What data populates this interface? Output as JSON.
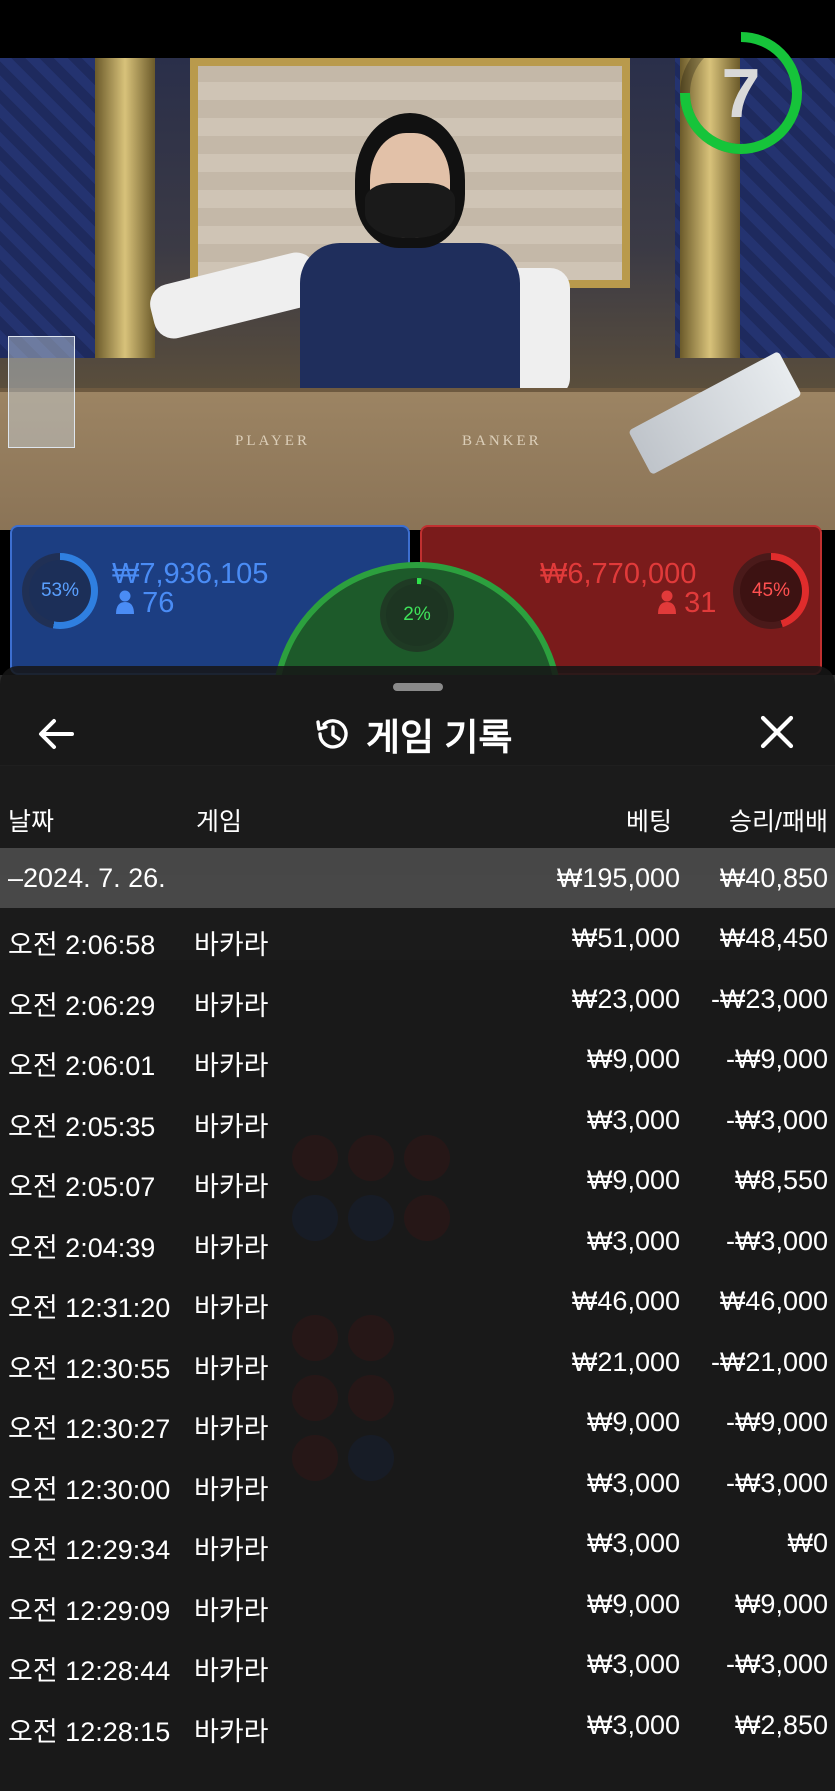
{
  "video": {
    "countdown": "7",
    "table_labels": [
      "PLAYER",
      "BANKER"
    ]
  },
  "bets": {
    "player": {
      "percent": "53%",
      "amount": "₩7,936,105",
      "count": "76",
      "color": "#2f7fe0"
    },
    "banker": {
      "percent": "45%",
      "amount": "₩6,770,000",
      "count": "31",
      "color": "#e02c2c"
    },
    "tie": {
      "percent": "2%",
      "color": "#2ee04a"
    }
  },
  "history": {
    "title": "게임 기록",
    "columns": {
      "date": "날짜",
      "game": "게임",
      "bet": "베팅",
      "result": "승리/패배"
    },
    "summary": {
      "date": "–2024. 7. 26.",
      "bet": "₩195,000",
      "result": "₩40,850"
    },
    "rows": [
      {
        "time": "오전 2:06:58",
        "game": "바카라",
        "bet": "₩51,000",
        "result": "₩48,450"
      },
      {
        "time": "오전 2:06:29",
        "game": "바카라",
        "bet": "₩23,000",
        "result": "-₩23,000"
      },
      {
        "time": "오전 2:06:01",
        "game": "바카라",
        "bet": "₩9,000",
        "result": "-₩9,000"
      },
      {
        "time": "오전 2:05:35",
        "game": "바카라",
        "bet": "₩3,000",
        "result": "-₩3,000"
      },
      {
        "time": "오전 2:05:07",
        "game": "바카라",
        "bet": "₩9,000",
        "result": "₩8,550"
      },
      {
        "time": "오전 2:04:39",
        "game": "바카라",
        "bet": "₩3,000",
        "result": "-₩3,000"
      },
      {
        "time": "오전 12:31:20",
        "game": "바카라",
        "bet": "₩46,000",
        "result": "₩46,000"
      },
      {
        "time": "오전 12:30:55",
        "game": "바카라",
        "bet": "₩21,000",
        "result": "-₩21,000"
      },
      {
        "time": "오전 12:30:27",
        "game": "바카라",
        "bet": "₩9,000",
        "result": "-₩9,000"
      },
      {
        "time": "오전 12:30:00",
        "game": "바카라",
        "bet": "₩3,000",
        "result": "-₩3,000"
      },
      {
        "time": "오전 12:29:34",
        "game": "바카라",
        "bet": "₩3,000",
        "result": "₩0"
      },
      {
        "time": "오전 12:29:09",
        "game": "바카라",
        "bet": "₩9,000",
        "result": "₩9,000"
      },
      {
        "time": "오전 12:28:44",
        "game": "바카라",
        "bet": "₩3,000",
        "result": "-₩3,000"
      },
      {
        "time": "오전 12:28:15",
        "game": "바카라",
        "bet": "₩3,000",
        "result": "₩2,850"
      }
    ]
  },
  "icons": {
    "back": "arrow-left-icon",
    "history": "history-clock-icon",
    "close": "close-icon",
    "person": "person-icon"
  }
}
